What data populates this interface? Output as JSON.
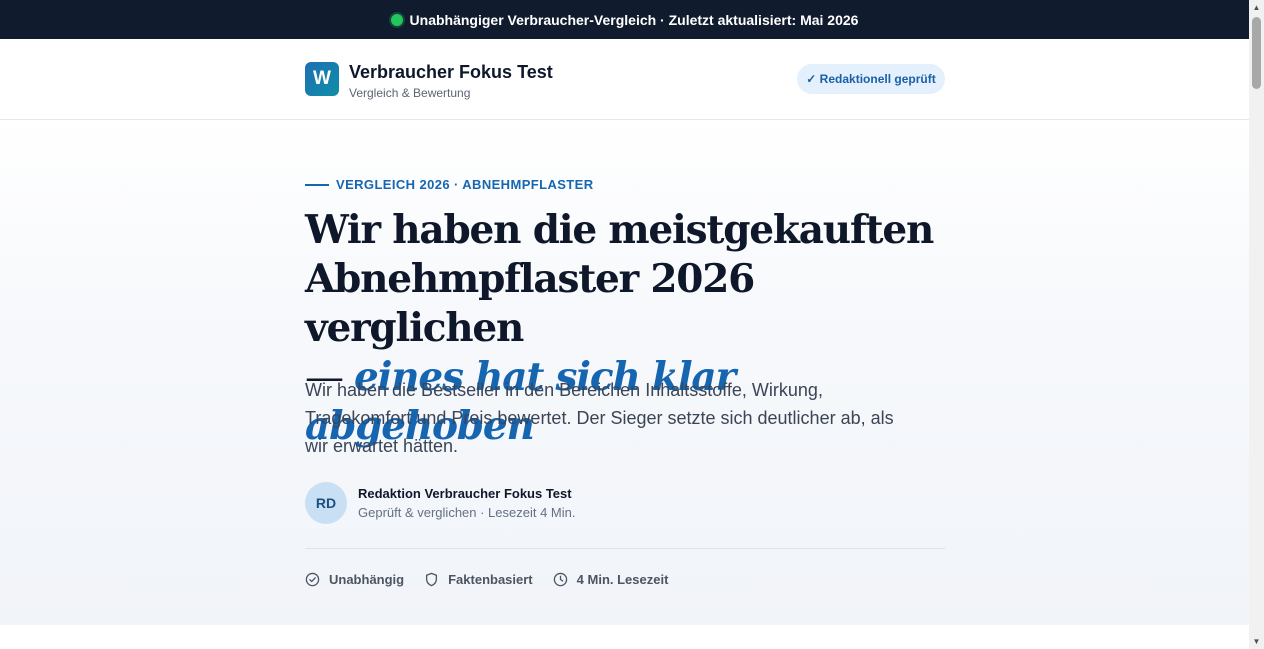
{
  "topbar": {
    "text": "Unabhängiger Verbraucher-Vergleich · Zuletzt aktualisiert: Mai 2026",
    "status_color": "#22c55e"
  },
  "header": {
    "logo_letter": "W",
    "brand_name": "Verbraucher Fokus Test",
    "brand_tagline": "Vergleich & Bewertung",
    "badge": "✓ Redaktionell geprüft"
  },
  "article": {
    "kicker": "VERGLEICH 2026 · ABNEHMPFLASTER",
    "headline_line1": "Wir haben die meistgekauften",
    "headline_line2": "Abnehmpflaster 2026 verglichen",
    "headline_dash": "— ",
    "headline_accent": "eines hat sich klar abgehoben",
    "lead": "Wir haben die Bestseller in den Bereichen Inhaltsstoffe, Wirkung, Tragekomfort und Preis bewertet. Der Sieger setzte sich deutlicher ab, als wir erwartet hätten.",
    "author": {
      "initials": "RD",
      "name": "Redaktion Verbraucher Fokus Test",
      "meta": "Geprüft & verglichen · Lesezeit 4 Min."
    },
    "features": [
      {
        "icon": "check-circle-icon",
        "label": "Unabhängig"
      },
      {
        "icon": "shield-icon",
        "label": "Faktenbasiert"
      },
      {
        "icon": "clock-icon",
        "label": "4 Min. Lesezeit"
      }
    ]
  },
  "colors": {
    "accent": "#1565b0",
    "topbar_bg": "#111b2e",
    "headline": "#0f172a"
  }
}
